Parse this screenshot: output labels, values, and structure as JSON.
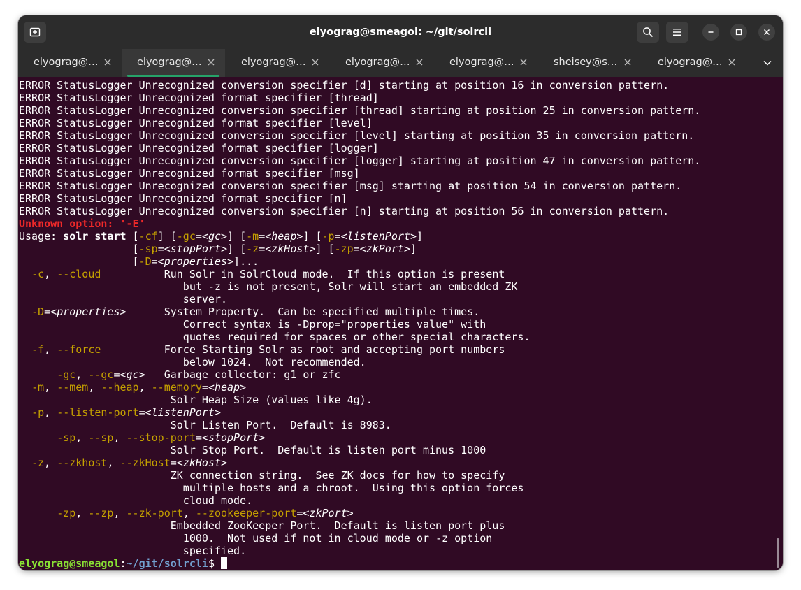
{
  "window": {
    "title": "elyograg@smeagol: ~/git/solrcli"
  },
  "header": {
    "icons": [
      "new-tab-icon",
      "search-icon",
      "hamburger-menu-icon",
      "minimize-icon",
      "maximize-icon",
      "close-icon"
    ]
  },
  "tabs": [
    {
      "label": "elyograg@…",
      "active": false
    },
    {
      "label": "elyograg@…",
      "active": true
    },
    {
      "label": "elyograg@…",
      "active": false
    },
    {
      "label": "elyograg@…",
      "active": false
    },
    {
      "label": "elyograg@…",
      "active": false
    },
    {
      "label": "sheisey@s…",
      "active": false
    },
    {
      "label": "elyograg@…",
      "active": false
    }
  ],
  "colors": {
    "terminal_bg": "#300a24",
    "titlebar_bg": "#2c2c2c",
    "active_tab_indicator": "#26a269",
    "error_red": "#ef2929",
    "option_yellow": "#c4a000",
    "prompt_green": "#8ae234",
    "prompt_blue": "#729fcf"
  },
  "terminal": {
    "lines": [
      "ERROR StatusLogger Unrecognized conversion specifier [d] starting at position 16 in conversion pattern.",
      "ERROR StatusLogger Unrecognized format specifier [thread]",
      "ERROR StatusLogger Unrecognized conversion specifier [thread] starting at position 25 in conversion pattern.",
      "ERROR StatusLogger Unrecognized format specifier [level]",
      "ERROR StatusLogger Unrecognized conversion specifier [level] starting at position 35 in conversion pattern.",
      "ERROR StatusLogger Unrecognized format specifier [logger]",
      "ERROR StatusLogger Unrecognized conversion specifier [logger] starting at position 47 in conversion pattern.",
      "ERROR StatusLogger Unrecognized format specifier [msg]",
      "ERROR StatusLogger Unrecognized conversion specifier [msg] starting at position 54 in conversion pattern.",
      "ERROR StatusLogger Unrecognized format specifier [n]",
      "ERROR StatusLogger Unrecognized conversion specifier [n] starting at position 56 in conversion pattern.",
      [
        {
          "t": "Unknown option: '-E'",
          "s": "red"
        }
      ],
      [
        {
          "t": "Usage: "
        },
        {
          "t": "solr start",
          "s": "b"
        },
        {
          "t": " ["
        },
        {
          "t": "-cf",
          "s": "ylw"
        },
        {
          "t": "] ["
        },
        {
          "t": "-gc",
          "s": "ylw"
        },
        {
          "t": "=<"
        },
        {
          "t": "gc",
          "s": "i"
        },
        {
          "t": ">] ["
        },
        {
          "t": "-m",
          "s": "ylw"
        },
        {
          "t": "=<"
        },
        {
          "t": "heap",
          "s": "i"
        },
        {
          "t": ">] ["
        },
        {
          "t": "-p",
          "s": "ylw"
        },
        {
          "t": "=<"
        },
        {
          "t": "listenPort",
          "s": "i"
        },
        {
          "t": ">]"
        }
      ],
      [
        {
          "t": "                  ["
        },
        {
          "t": "-sp",
          "s": "ylw"
        },
        {
          "t": "=<"
        },
        {
          "t": "stopPort",
          "s": "i"
        },
        {
          "t": ">] ["
        },
        {
          "t": "-z",
          "s": "ylw"
        },
        {
          "t": "=<"
        },
        {
          "t": "zkHost",
          "s": "i"
        },
        {
          "t": ">] ["
        },
        {
          "t": "-zp",
          "s": "ylw"
        },
        {
          "t": "=<"
        },
        {
          "t": "zkPort",
          "s": "i"
        },
        {
          "t": ">]"
        }
      ],
      [
        {
          "t": "                  ["
        },
        {
          "t": "-D",
          "s": "ylw"
        },
        {
          "t": "=<"
        },
        {
          "t": "properties",
          "s": "i"
        },
        {
          "t": ">]..."
        }
      ],
      [
        {
          "t": "  "
        },
        {
          "t": "-c",
          "s": "ylw"
        },
        {
          "t": ", "
        },
        {
          "t": "--cloud",
          "s": "ylw"
        },
        {
          "t": "          Run Solr in SolrCloud mode.  If this option is present"
        }
      ],
      "                          but -z is not present, Solr will start an embedded ZK",
      "                          server.",
      [
        {
          "t": "  "
        },
        {
          "t": "-D",
          "s": "ylw"
        },
        {
          "t": "=<"
        },
        {
          "t": "properties",
          "s": "i"
        },
        {
          "t": ">      System Property.  Can be specified multiple times."
        }
      ],
      "                          Correct syntax is -Dprop=\"properties value\" with",
      "                          quotes required for spaces or other special characters.",
      [
        {
          "t": "  "
        },
        {
          "t": "-f",
          "s": "ylw"
        },
        {
          "t": ", "
        },
        {
          "t": "--force",
          "s": "ylw"
        },
        {
          "t": "          Force Starting Solr as root and accepting port numbers"
        }
      ],
      "                          below 1024.  Not recommended.",
      [
        {
          "t": "      "
        },
        {
          "t": "-gc",
          "s": "ylw"
        },
        {
          "t": ", "
        },
        {
          "t": "--gc",
          "s": "ylw"
        },
        {
          "t": "=<"
        },
        {
          "t": "gc",
          "s": "i"
        },
        {
          "t": ">   Garbage collector: g1 or zfc"
        }
      ],
      [
        {
          "t": "  "
        },
        {
          "t": "-m",
          "s": "ylw"
        },
        {
          "t": ", "
        },
        {
          "t": "--mem",
          "s": "ylw"
        },
        {
          "t": ", "
        },
        {
          "t": "--heap",
          "s": "ylw"
        },
        {
          "t": ", "
        },
        {
          "t": "--memory",
          "s": "ylw"
        },
        {
          "t": "=<"
        },
        {
          "t": "heap",
          "s": "i"
        },
        {
          "t": ">"
        }
      ],
      "                        Solr Heap Size (values like 4g).",
      [
        {
          "t": "  "
        },
        {
          "t": "-p",
          "s": "ylw"
        },
        {
          "t": ", "
        },
        {
          "t": "--listen-port",
          "s": "ylw"
        },
        {
          "t": "=<"
        },
        {
          "t": "listenPort",
          "s": "i"
        },
        {
          "t": ">"
        }
      ],
      "                        Solr Listen Port.  Default is 8983.",
      [
        {
          "t": "      "
        },
        {
          "t": "-sp",
          "s": "ylw"
        },
        {
          "t": ", "
        },
        {
          "t": "--sp",
          "s": "ylw"
        },
        {
          "t": ", "
        },
        {
          "t": "--stop-port",
          "s": "ylw"
        },
        {
          "t": "=<"
        },
        {
          "t": "stopPort",
          "s": "i"
        },
        {
          "t": ">"
        }
      ],
      "                        Solr Stop Port.  Default is listen port minus 1000",
      [
        {
          "t": "  "
        },
        {
          "t": "-z",
          "s": "ylw"
        },
        {
          "t": ", "
        },
        {
          "t": "--zkhost",
          "s": "ylw"
        },
        {
          "t": ", "
        },
        {
          "t": "--zkHost",
          "s": "ylw"
        },
        {
          "t": "=<"
        },
        {
          "t": "zkHost",
          "s": "i"
        },
        {
          "t": ">"
        }
      ],
      "                        ZK connection string.  See ZK docs for how to specify",
      "                          multiple hosts and a chroot.  Using this option forces",
      "                          cloud mode.",
      [
        {
          "t": "      "
        },
        {
          "t": "-zp",
          "s": "ylw"
        },
        {
          "t": ", "
        },
        {
          "t": "--zp",
          "s": "ylw"
        },
        {
          "t": ", "
        },
        {
          "t": "--zk-port",
          "s": "ylw"
        },
        {
          "t": ", "
        },
        {
          "t": "--zookeeper-port",
          "s": "ylw"
        },
        {
          "t": "=<"
        },
        {
          "t": "zkPort",
          "s": "i"
        },
        {
          "t": ">"
        }
      ],
      "                        Embedded ZooKeeper Port.  Default is listen port plus",
      "                          1000.  Not used if not in cloud mode or -z option",
      "                          specified."
    ],
    "prompt": {
      "user_host": "elyograg@smeagol",
      "separator": ":",
      "path": "~/git/solrcli",
      "symbol": "$ "
    }
  }
}
